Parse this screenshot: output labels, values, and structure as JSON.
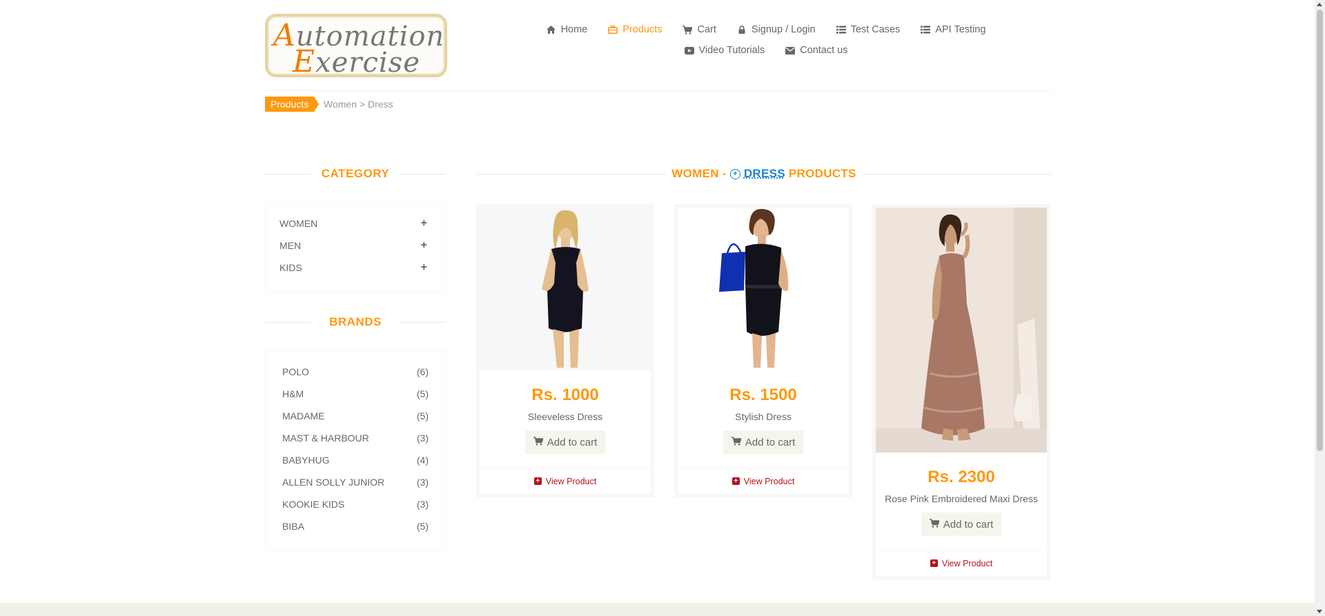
{
  "logo": {
    "line1_cap": "A",
    "line1_rest": "utomation",
    "line2_cap": "E",
    "line2_rest": "xercise"
  },
  "nav": {
    "row1": [
      {
        "label": "Home",
        "icon": "home-icon",
        "active": false
      },
      {
        "label": "Products",
        "icon": "briefcase-icon",
        "active": true
      },
      {
        "label": "Cart",
        "icon": "cart-icon",
        "active": false
      },
      {
        "label": "Signup / Login",
        "icon": "lock-icon",
        "active": false
      },
      {
        "label": "Test Cases",
        "icon": "list-icon",
        "active": false
      },
      {
        "label": "API Testing",
        "icon": "list-icon",
        "active": false
      }
    ],
    "row2": [
      {
        "label": "Video Tutorials",
        "icon": "youtube-play-icon"
      },
      {
        "label": "Contact us",
        "icon": "envelope-icon"
      }
    ]
  },
  "breadcrumb": {
    "tag": "Products",
    "path": "Women > Dress"
  },
  "sidebar": {
    "category_title": "CATEGORY",
    "categories": [
      "WOMEN",
      "MEN",
      "KIDS"
    ],
    "brands_title": "BRANDS",
    "brands": [
      {
        "name": "POLO",
        "count": "(6)"
      },
      {
        "name": "H&M",
        "count": "(5)"
      },
      {
        "name": "MADAME",
        "count": "(5)"
      },
      {
        "name": "MAST & HARBOUR",
        "count": "(3)"
      },
      {
        "name": "BABYHUG",
        "count": "(4)"
      },
      {
        "name": "ALLEN SOLLY JUNIOR",
        "count": "(3)"
      },
      {
        "name": "KOOKIE KIDS",
        "count": "(3)"
      },
      {
        "name": "BIBA",
        "count": "(5)"
      }
    ]
  },
  "main": {
    "title_prefix": "WOMEN -",
    "title_highlight": "DRESS",
    "title_suffix": "PRODUCTS",
    "products": [
      {
        "price": "Rs. 1000",
        "name": "Sleeveless Dress",
        "add_label": "Add to cart",
        "view_label": "View Product"
      },
      {
        "price": "Rs. 1500",
        "name": "Stylish Dress",
        "add_label": "Add to cart",
        "view_label": "View Product"
      },
      {
        "price": "Rs. 2300",
        "name": "Rose Pink Embroidered Maxi Dress",
        "add_label": "Add to cart",
        "view_label": "View Product"
      }
    ]
  },
  "colors": {
    "accent": "#fe980f",
    "text": "#696763",
    "link_red": "#b3141f",
    "highlight_blue": "#1a85c8"
  }
}
